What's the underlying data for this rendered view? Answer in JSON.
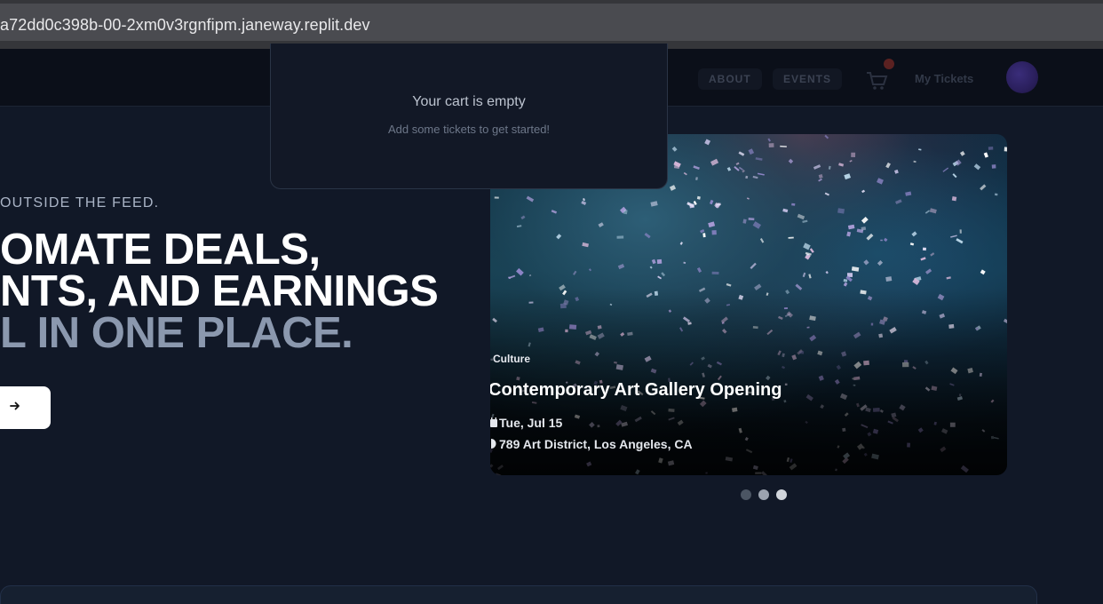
{
  "browser": {
    "url": "a72dd0c398b-00-2xm0v3rgnfipm.janeway.replit.dev"
  },
  "nav": {
    "about": "ABOUT",
    "events": "EVENTS",
    "my_tickets": "My Tickets",
    "cart_icon": "cart-icon",
    "avatar_icon": "avatar"
  },
  "cart": {
    "empty_title": "Your cart is empty",
    "empty_subtitle": "Add some tickets to get started!"
  },
  "hero": {
    "tagline": "OUTSIDE THE FEED.",
    "headline_line1": "OMATE DEALS,",
    "headline_line2": "NTS, AND EARNINGS",
    "headline_line3": "L IN ONE PLACE.",
    "cta_icon": "arrow-right-icon"
  },
  "carousel": {
    "category": "Culture",
    "title": "Contemporary Art Gallery Opening",
    "date": "Tue, Jul 15",
    "location": "789 Art District, Los Angeles, CA",
    "date_icon": "calendar-icon",
    "location_icon": "map-pin-icon",
    "slide_count": 3,
    "active_slide": 3
  },
  "colors": {
    "background": "#111827",
    "accent_muted": "#8b98ae",
    "dot_inactive": "#4b5563",
    "dot_active": "#d1d5db"
  }
}
